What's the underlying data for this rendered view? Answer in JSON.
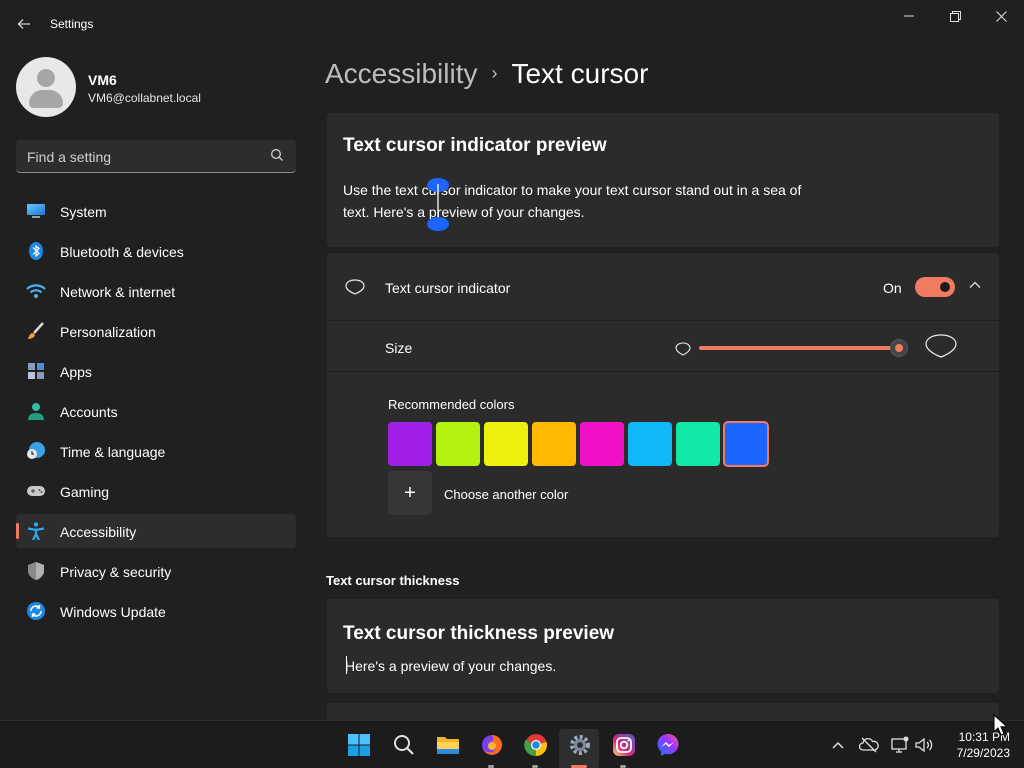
{
  "window": {
    "title": "Settings",
    "controls": {
      "minimize": "—",
      "maximize": "❐",
      "close": "✕"
    }
  },
  "profile": {
    "name": "VM6",
    "email": "VM6@collabnet.local"
  },
  "search": {
    "placeholder": "Find a setting"
  },
  "sidebar": {
    "items": [
      {
        "label": "System",
        "icon": "system-icon"
      },
      {
        "label": "Bluetooth & devices",
        "icon": "bluetooth-icon"
      },
      {
        "label": "Network & internet",
        "icon": "wifi-icon"
      },
      {
        "label": "Personalization",
        "icon": "brush-icon"
      },
      {
        "label": "Apps",
        "icon": "apps-icon"
      },
      {
        "label": "Accounts",
        "icon": "person-icon"
      },
      {
        "label": "Time & language",
        "icon": "clock-globe-icon"
      },
      {
        "label": "Gaming",
        "icon": "gamepad-icon"
      },
      {
        "label": "Accessibility",
        "icon": "accessibility-icon",
        "active": true
      },
      {
        "label": "Privacy & security",
        "icon": "shield-icon"
      },
      {
        "label": "Windows Update",
        "icon": "update-icon"
      }
    ]
  },
  "breadcrumb": {
    "parent": "Accessibility",
    "separator": "›",
    "current": "Text cursor"
  },
  "preview": {
    "title": "Text cursor indicator preview",
    "text": "Use the text cursor indicator to make your text cursor stand out in a sea of text. Here's a preview of your changes."
  },
  "indicator": {
    "label": "Text cursor indicator",
    "state": "On",
    "size_label": "Size",
    "size_level": 0.95,
    "recommended_label": "Recommended colors",
    "colors": [
      "#a020e8",
      "#b4f010",
      "#f0f010",
      "#ffb900",
      "#f010c8",
      "#10b8f8",
      "#10e8a8",
      "#1e64ff"
    ],
    "selected_color_index": 7,
    "add_symbol": "+",
    "choose_label": "Choose another color"
  },
  "thickness": {
    "section_title": "Text cursor thickness",
    "preview_title": "Text cursor thickness preview",
    "preview_text": "Here's a preview of your changes."
  },
  "taskbar": {
    "apps": [
      "start-icon",
      "search-icon",
      "file-explorer-icon",
      "firefox-icon",
      "chrome-icon",
      "settings-icon",
      "instagram-icon",
      "messenger-icon"
    ],
    "time": "10:31 PM",
    "date": "7/29/2023"
  },
  "colors": {
    "accent": "#f07b61",
    "background": "#202020",
    "card": "#2b2b2b"
  }
}
